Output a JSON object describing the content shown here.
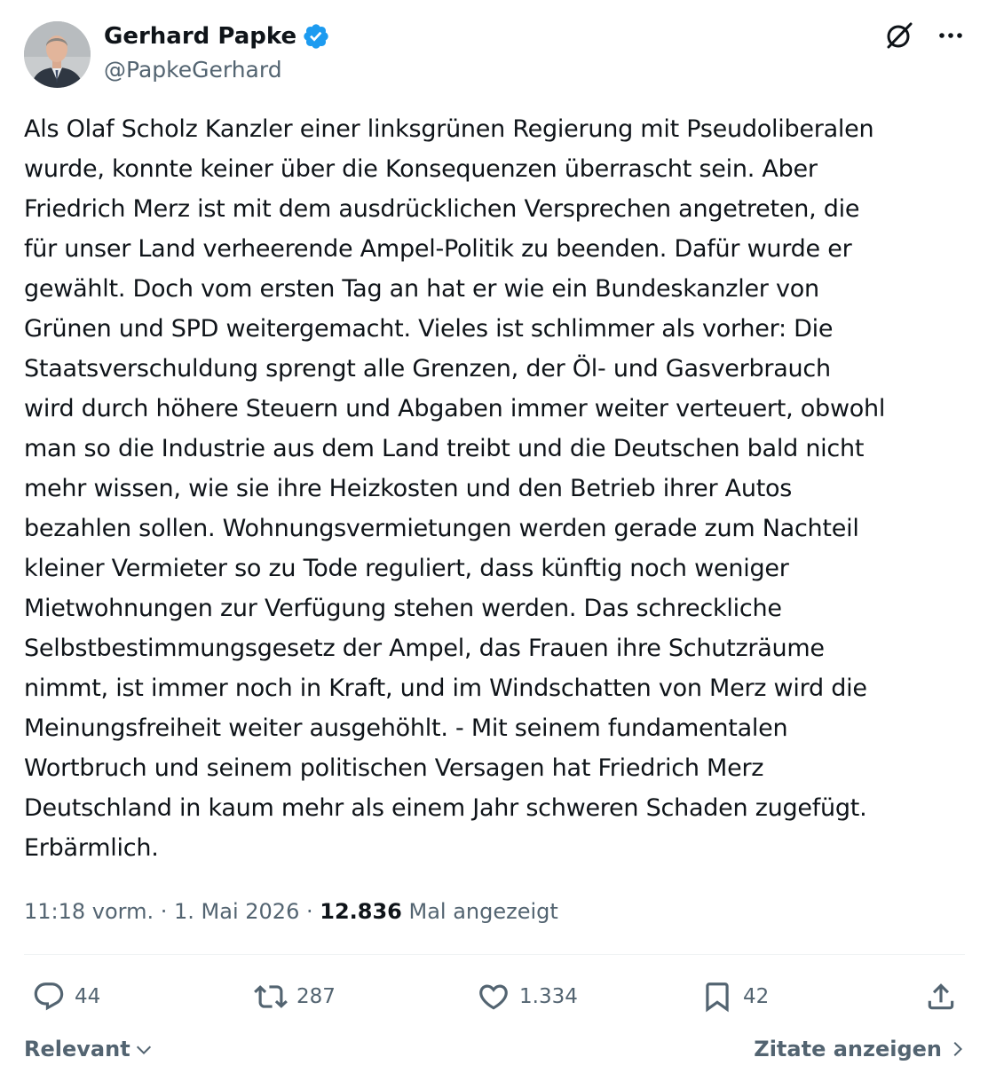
{
  "author": {
    "name": "Gerhard Papke",
    "handle": "@PapkeGerhard",
    "verified": true,
    "avatar_icon": "person-portrait",
    "verified_color": "#1d9bf0"
  },
  "top_actions": {
    "grok_icon": "grok-icon",
    "more_icon": "more-horizontal-icon"
  },
  "tweet": {
    "text": "Als Olaf Scholz Kanzler einer linksgrünen Regierung mit Pseudoliberalen\nwurde, konnte keiner über die Konsequenzen überrascht sein. Aber\nFriedrich Merz ist mit dem ausdrücklichen Versprechen angetreten, die\nfür unser Land verheerende Ampel-Politik zu beenden. Dafür wurde er\ngewählt. Doch vom ersten Tag an hat er wie ein Bundeskanzler von\nGrünen und SPD weitergemacht. Vieles ist schlimmer als vorher: Die\nStaatsverschuldung sprengt alle Grenzen, der Öl- und Gasverbrauch\nwird durch höhere Steuern und Abgaben immer weiter verteuert, obwohl\nman so die Industrie aus dem Land treibt und die Deutschen bald nicht\nmehr wissen, wie sie ihre Heizkosten und den Betrieb ihrer Autos\nbezahlen sollen. Wohnungsvermietungen werden gerade zum Nachteil\nkleiner Vermieter so zu Tode reguliert, dass künftig noch weniger\nMietwohnungen zur Verfügung stehen werden. Das schreckliche\nSelbstbestimmungsgesetz der Ampel, das Frauen ihre Schutzräume\nnimmt, ist immer noch in Kraft, und im Windschatten von Merz wird die\nMeinungsfreiheit weiter ausgehöhlt. - Mit seinem fundamentalen\nWortbruch und seinem politischen Versagen hat Friedrich Merz\nDeutschland in kaum mehr als einem Jahr schweren Schaden zugefügt.\nErbärmlich.",
    "time": "11:18 vorm.",
    "separator": " · ",
    "date": "1. Mai 2026",
    "views_count": "12.836",
    "views_label": " Mal angezeigt"
  },
  "actions": {
    "replies": "44",
    "reposts": "287",
    "likes": "1.334",
    "bookmarks": "42"
  },
  "footer": {
    "sort_label": "Relevant",
    "quotes_label": "Zitate anzeigen"
  }
}
